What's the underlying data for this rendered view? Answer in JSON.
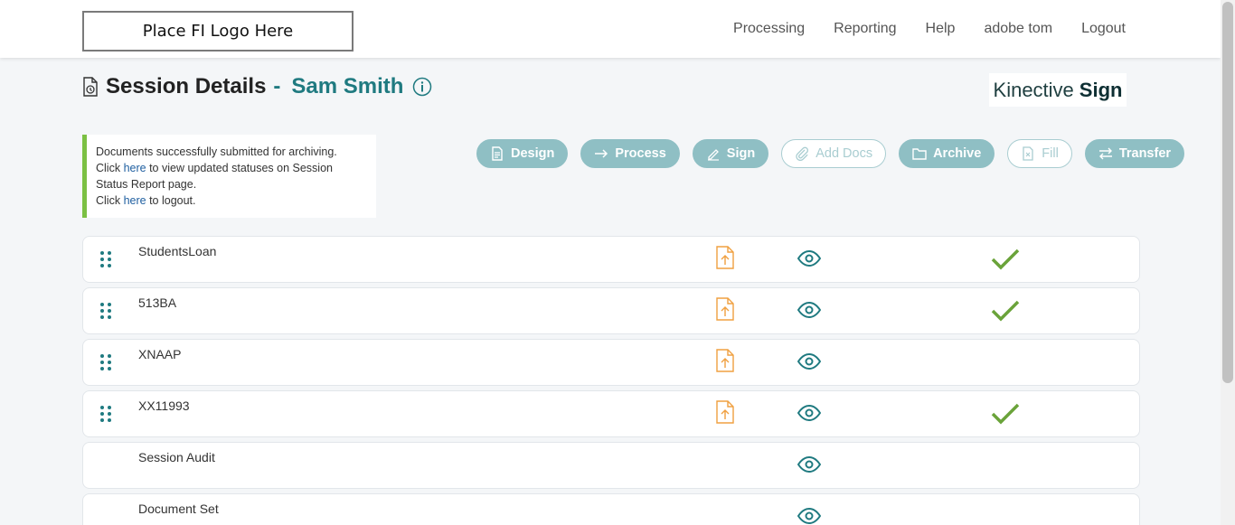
{
  "header": {
    "logo_text": "Place FI Logo Here",
    "nav": [
      {
        "label": "Processing"
      },
      {
        "label": "Reporting"
      },
      {
        "label": "Help"
      },
      {
        "label": "adobe tom"
      },
      {
        "label": "Logout"
      }
    ]
  },
  "page": {
    "title": "Session Details",
    "separator": "-",
    "customer_name": "Sam Smith",
    "brand_light": "Kinective",
    "brand_bold": "Sign"
  },
  "notice": {
    "line1": "Documents successfully submitted for archiving.",
    "line2_pre": "Click ",
    "line2_link": "here",
    "line2_post": " to view updated statuses on Session Status Report page.",
    "line3_pre": "Click ",
    "line3_link": "here",
    "line3_post": " to logout."
  },
  "actions": [
    {
      "label": "Design",
      "icon": "document-icon",
      "enabled": true
    },
    {
      "label": "Process",
      "icon": "arrow-right-icon",
      "enabled": true
    },
    {
      "label": "Sign",
      "icon": "pen-icon",
      "enabled": true
    },
    {
      "label": "Add Docs",
      "icon": "paperclip-icon",
      "enabled": false
    },
    {
      "label": "Archive",
      "icon": "folder-icon",
      "enabled": true
    },
    {
      "label": "Fill",
      "icon": "form-icon",
      "enabled": false
    },
    {
      "label": "Transfer",
      "icon": "transfer-icon",
      "enabled": true
    }
  ],
  "documents": [
    {
      "name": "StudentsLoan",
      "draggable": true,
      "upload": true,
      "view": true,
      "complete": true
    },
    {
      "name": "513BA",
      "draggable": true,
      "upload": true,
      "view": true,
      "complete": true
    },
    {
      "name": "XNAAP",
      "draggable": true,
      "upload": true,
      "view": true,
      "complete": false
    },
    {
      "name": "XX11993",
      "draggable": true,
      "upload": true,
      "view": true,
      "complete": true
    },
    {
      "name": "Session Audit",
      "draggable": false,
      "upload": false,
      "view": true,
      "complete": false
    },
    {
      "name": "Document Set",
      "draggable": false,
      "upload": false,
      "view": true,
      "complete": false
    }
  ],
  "colors": {
    "accent": "#1f7a80",
    "button": "#8fbfc4",
    "success": "#6aa33a",
    "upload": "#f0a040",
    "notice_bar": "#7bc043"
  }
}
